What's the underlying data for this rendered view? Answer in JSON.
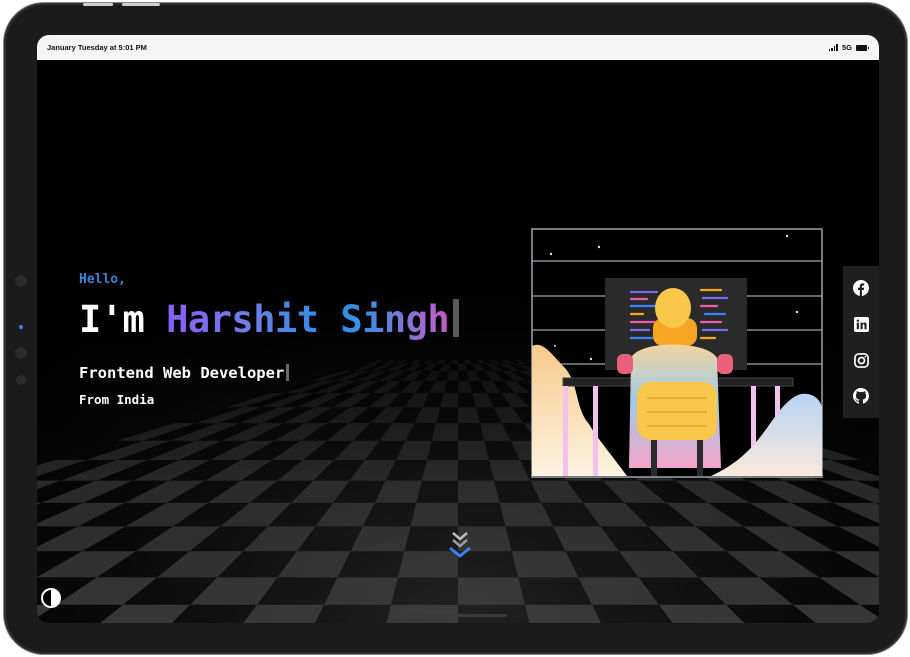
{
  "statusbar": {
    "time_text": "January Tuesday at 5:01 PM",
    "network": "5G"
  },
  "hero": {
    "greeting": "Hello,",
    "intro_prefix": "I'm ",
    "name": "Harshit Singh",
    "role": "Frontend Web Developer",
    "location": "From India"
  },
  "social": {
    "items": [
      {
        "icon": "facebook-icon"
      },
      {
        "icon": "linkedin-icon"
      },
      {
        "icon": "instagram-icon"
      },
      {
        "icon": "github-icon"
      }
    ]
  },
  "controls": {
    "scroll_icon": "chevron-double-down-icon",
    "theme_icon": "contrast-icon"
  },
  "colors": {
    "accent_blue": "#3b82d6",
    "name_gradient_start": "#8b5cf6",
    "name_gradient_end": "#c95ac6",
    "background": "#000000"
  }
}
